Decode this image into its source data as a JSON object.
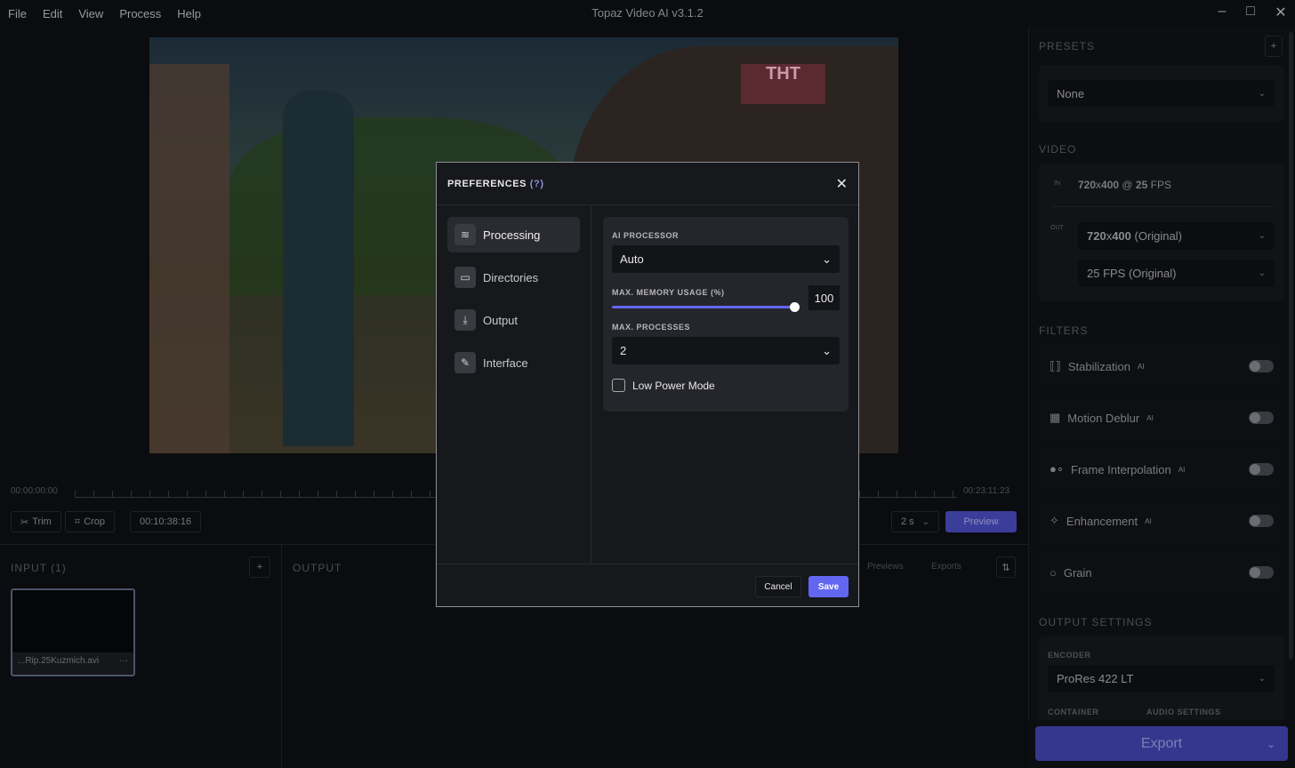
{
  "app": {
    "title": "Topaz Video AI  v3.1.2",
    "menu": [
      "File",
      "Edit",
      "View",
      "Process",
      "Help"
    ]
  },
  "timeline": {
    "start": "00:00:00:00",
    "end": "00:23:11:23",
    "trim": "Trim",
    "crop": "Crop",
    "current": "00:10:38:16",
    "duration": "2 s",
    "preview": "Preview"
  },
  "input": {
    "header": "INPUT (1)",
    "file": "...Rip.25Kuzmich.avi",
    "more": "···",
    "add": "+"
  },
  "output": {
    "header": "OUTPUT",
    "tabs": [
      "Previews",
      "Exports"
    ]
  },
  "right": {
    "presets_header": "PRESETS",
    "preset": "None",
    "add": "+",
    "video_header": "VIDEO",
    "in_tag": "IN",
    "in_res": "720",
    "in_x": "x",
    "in_res2": "400",
    "in_at": " @ ",
    "in_fps": "25",
    "in_fps_unit": " FPS",
    "out_tag": "OUT",
    "out_res": "720",
    "out_x": "x",
    "out_res2": "400",
    "out_res_note": " (Original)",
    "out_fps": "25 FPS (Original)",
    "filters_header": "FILTERS",
    "filters": [
      {
        "label": "Stabilization",
        "ai": "AI",
        "on": false
      },
      {
        "label": "Motion Deblur",
        "ai": "AI",
        "on": false
      },
      {
        "label": "Frame Interpolation",
        "ai": "AI",
        "on": false
      },
      {
        "label": "Enhancement",
        "ai": "AI",
        "on": false
      },
      {
        "label": "Grain",
        "ai": "",
        "on": false
      }
    ],
    "output_header": "OUTPUT SETTINGS",
    "encoder_label": "ENCODER",
    "encoder": "ProRes 422 LT",
    "container_label": "CONTAINER",
    "audio_label": "AUDIO SETTINGS",
    "export": "Export"
  },
  "dialog": {
    "title": "PREFERENCES",
    "help": "(?)",
    "nav": [
      {
        "label": "Processing",
        "icon": "sliders-icon"
      },
      {
        "label": "Directories",
        "icon": "folder-icon"
      },
      {
        "label": "Output",
        "icon": "download-icon"
      },
      {
        "label": "Interface",
        "icon": "edit-screen-icon"
      }
    ],
    "ai_processor_label": "AI PROCESSOR",
    "ai_processor": "Auto",
    "memory_label": "MAX. MEMORY USAGE (%)",
    "memory": "100",
    "memory_fraction": 1.0,
    "processes_label": "MAX. PROCESSES",
    "processes": "2",
    "low_power": "Low Power Mode",
    "low_power_checked": false,
    "cancel": "Cancel",
    "save": "Save"
  },
  "colors": {
    "accent": "#6366f1",
    "accent_dim": "#3b3d9a"
  }
}
